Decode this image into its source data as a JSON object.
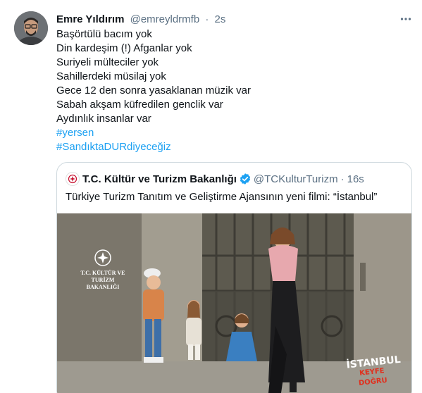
{
  "tweet": {
    "author_name": "Emre Yıldırım",
    "handle": "@emreyldrmfb",
    "separator": "·",
    "time": "2s",
    "lines": [
      "Başörtülü bacım yok",
      "Din kardeşim (!) Afganlar yok",
      "Suriyeli mülteciler yok",
      "Sahillerdeki müsilaj yok",
      "Gece 12 den sonra yasaklanan müzik var",
      "Sabah akşam küfredilen genclik var",
      "Aydınlık insanlar var"
    ],
    "hashtags": [
      "#yersen",
      "#SandıktaDURdiyeceğiz"
    ],
    "more_icon": "more-dots-icon"
  },
  "quoted_tweet": {
    "author_name": "T.C. Kültür ve Turizm Bakanlığı",
    "handle": "@TCKulturTurizm",
    "separator": "·",
    "time": "16s",
    "text": "Türkiye Turizm Tanıtım ve Geliştirme Ajansının yeni filmi: “İstanbul”",
    "media": {
      "logo_text_line1": "T.C. KÜLTÜR VE TURİZM",
      "logo_text_line2": "BAKANLIĞI",
      "title_line1": "İSTANBUL",
      "title_line2": "KEYFE DOĞRU"
    }
  },
  "colors": {
    "link": "#1da1f2",
    "secondary_text": "#5b7083",
    "border": "#cfd9de",
    "verified": "#1da1f2"
  }
}
